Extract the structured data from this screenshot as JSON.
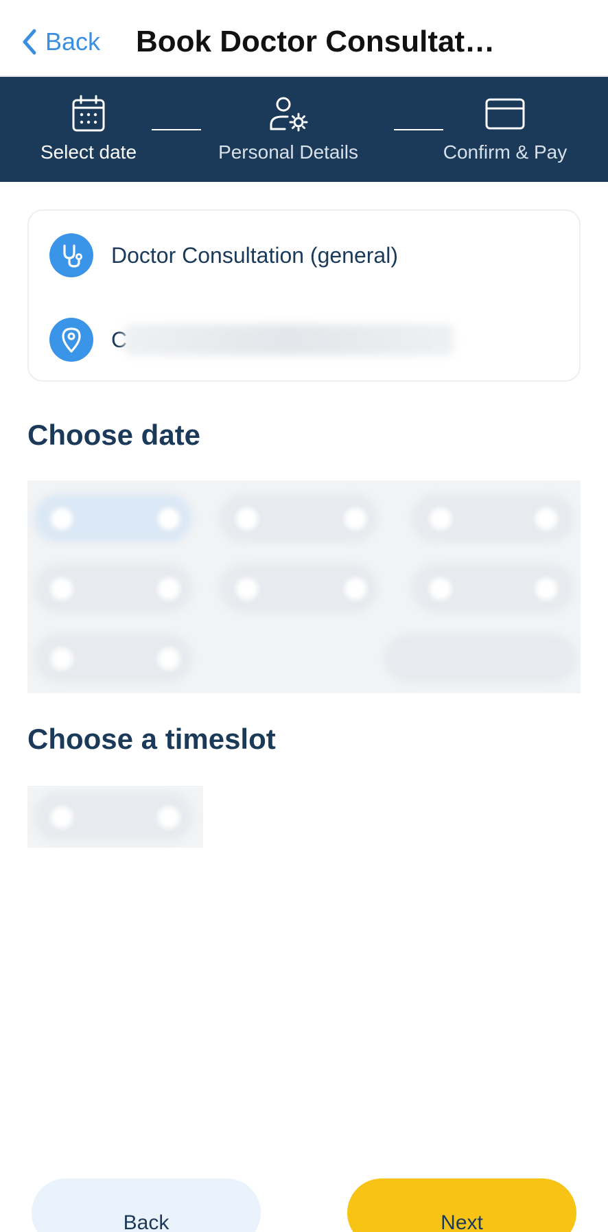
{
  "header": {
    "back_label": "Back",
    "title": "Book Doctor Consultat…"
  },
  "stepper": {
    "steps": [
      {
        "label": "Select date",
        "icon": "calendar-icon",
        "state": "active"
      },
      {
        "label": "Personal Details",
        "icon": "user-settings-icon",
        "state": "inactive"
      },
      {
        "label": "Confirm & Pay",
        "icon": "credit-card-icon",
        "state": "inactive"
      }
    ]
  },
  "info": {
    "service": "Doctor Consultation (general)",
    "service_icon": "stethoscope-icon",
    "location_first_char": "C",
    "location_icon": "location-pin-icon"
  },
  "sections": {
    "choose_date": "Choose date",
    "choose_timeslot": "Choose a timeslot"
  },
  "footer": {
    "back_label": "Back",
    "next_label": "Next"
  },
  "colors": {
    "primary_dark": "#1b3a59",
    "accent_blue": "#3a95e8",
    "next_yellow": "#f7c315",
    "back_light": "#eaf3fb"
  }
}
